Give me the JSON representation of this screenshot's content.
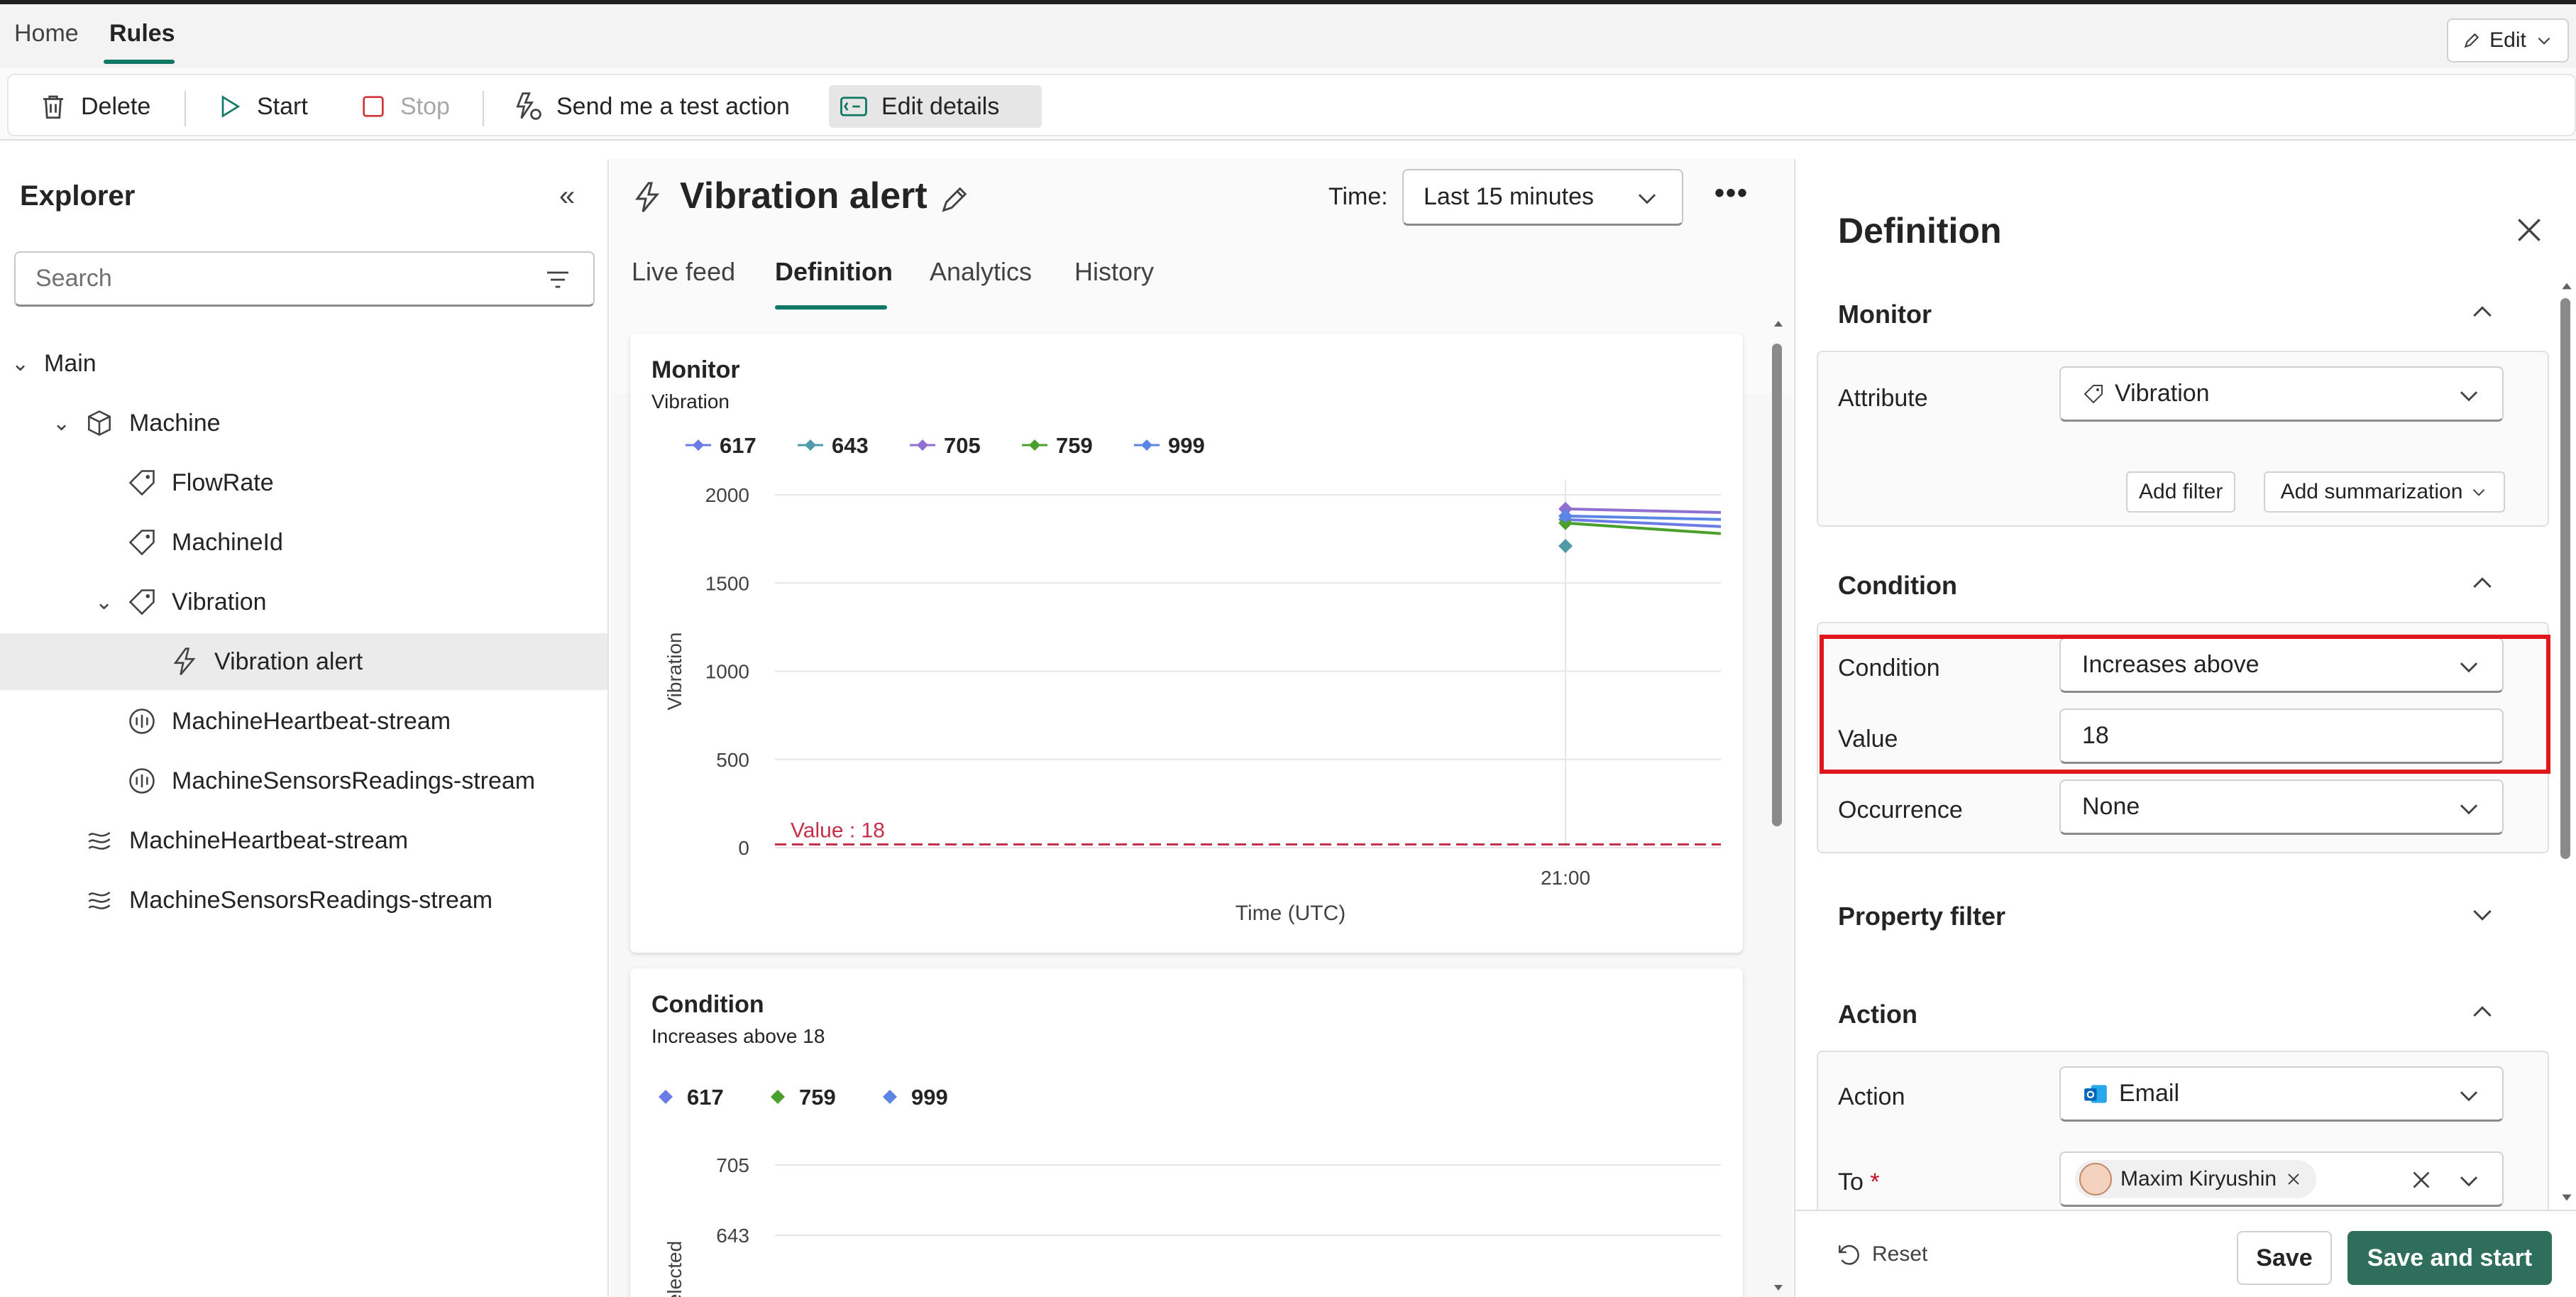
{
  "topnav": {
    "home": "Home",
    "rules": "Rules",
    "edit": "Edit"
  },
  "toolbar": {
    "delete": "Delete",
    "start": "Start",
    "stop": "Stop",
    "test_action": "Send me a test action",
    "edit_details": "Edit details"
  },
  "explorer": {
    "title": "Explorer",
    "search_placeholder": "Search",
    "items": [
      {
        "label": "Main"
      },
      {
        "label": "Machine"
      },
      {
        "label": "FlowRate"
      },
      {
        "label": "MachineId"
      },
      {
        "label": "Vibration"
      },
      {
        "label": "Vibration alert"
      },
      {
        "label": "MachineHeartbeat-stream"
      },
      {
        "label": "MachineSensorsReadings-stream"
      },
      {
        "label": "MachineHeartbeat-stream"
      },
      {
        "label": "MachineSensorsReadings-stream"
      }
    ]
  },
  "center": {
    "title": "Vibration alert",
    "time_label": "Time:",
    "time_value": "Last 15 minutes",
    "tabs": [
      "Live feed",
      "Definition",
      "Analytics",
      "History"
    ]
  },
  "chart_data": [
    {
      "type": "line",
      "title": "Monitor",
      "subtitle": "Vibration",
      "xlabel": "Time (UTC)",
      "ylabel": "Vibration",
      "ylim": [
        0,
        2000
      ],
      "yticks": [
        "2000",
        "1500",
        "1000",
        "500",
        "0"
      ],
      "xticks": [
        "21:00"
      ],
      "threshold_label": "Value : 18",
      "threshold": 18,
      "legend": [
        "617",
        "643",
        "705",
        "759",
        "999"
      ],
      "series": [
        {
          "name": "617",
          "color": "#6b7ce6",
          "values": [
            1860,
            1820
          ]
        },
        {
          "name": "643",
          "color": "#4f9aa8",
          "values": [
            1710
          ]
        },
        {
          "name": "705",
          "color": "#8f6fd0",
          "values": [
            1920,
            1900
          ]
        },
        {
          "name": "759",
          "color": "#4aa02c",
          "values": [
            1840,
            1780
          ]
        },
        {
          "name": "999",
          "color": "#5b86e5",
          "values": [
            1880,
            1860
          ]
        }
      ]
    },
    {
      "type": "scatter",
      "title": "Condition",
      "subtitle": "Increases above 18",
      "ylabel": "selected",
      "yticks": [
        "705",
        "643"
      ],
      "legend": [
        "617",
        "759",
        "999"
      ],
      "series": [
        {
          "name": "617",
          "color": "#6b7ce6"
        },
        {
          "name": "759",
          "color": "#4aa02c"
        },
        {
          "name": "999",
          "color": "#5b86e5"
        }
      ]
    }
  ],
  "definition": {
    "title": "Definition",
    "monitor": {
      "heading": "Monitor",
      "attribute_label": "Attribute",
      "attribute_value": "Vibration",
      "add_filter": "Add filter",
      "add_summarization": "Add summarization"
    },
    "condition": {
      "heading": "Condition",
      "condition_label": "Condition",
      "condition_value": "Increases above",
      "value_label": "Value",
      "value_value": "18",
      "occurrence_label": "Occurrence",
      "occurrence_value": "None"
    },
    "property_filter": {
      "heading": "Property filter"
    },
    "action": {
      "heading": "Action",
      "action_label": "Action",
      "action_value": "Email",
      "to_label": "To",
      "to_required": "*",
      "recipient": "Maxim Kiryushin"
    },
    "footer": {
      "reset": "Reset",
      "save": "Save",
      "save_start": "Save and start"
    }
  },
  "colors": {
    "accent": "#117865",
    "primary_button": "#2f6e5a",
    "highlight": "#e0161d",
    "threshold": "#c4314b"
  }
}
